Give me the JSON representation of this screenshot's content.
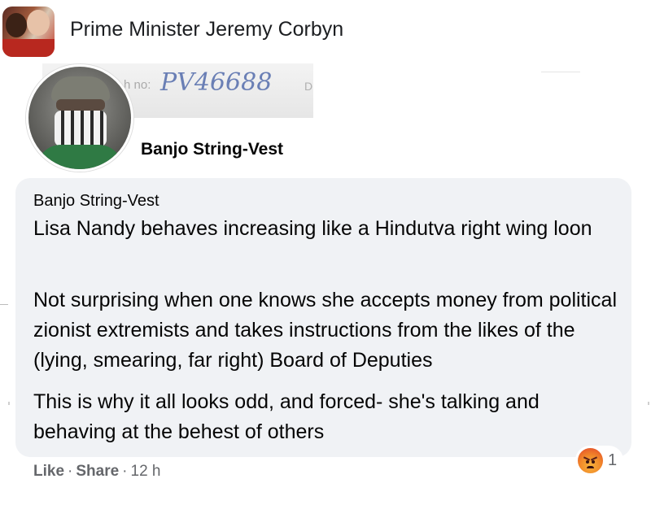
{
  "group": {
    "title": "Prime Minister Jeremy Corbyn"
  },
  "profile": {
    "name": "Banjo String-Vest",
    "background_text": {
      "partial_label": "h no:",
      "handwritten": "PV46688",
      "partial_letter": "D"
    }
  },
  "comment": {
    "author": "Banjo String-Vest",
    "paragraphs": [
      "Lisa Nandy behaves increasing like a Hindutva right wing loon",
      "Not surprising when one knows she accepts money from political zionist extremists and takes instructions from the likes of the (lying, smearing, far right) Board of Deputies",
      "This is why it all looks odd, and forced- she's talking and behaving at the behest of others"
    ],
    "reaction": {
      "icon": "angry-face-icon",
      "count": "1"
    },
    "actions": {
      "like": "Like",
      "sep1": "·",
      "share": "Share",
      "sep2": "·",
      "time": "12 h"
    }
  },
  "colors": {
    "bubble": "#f0f2f5",
    "meta_text": "#65676b",
    "text": "#050505"
  }
}
